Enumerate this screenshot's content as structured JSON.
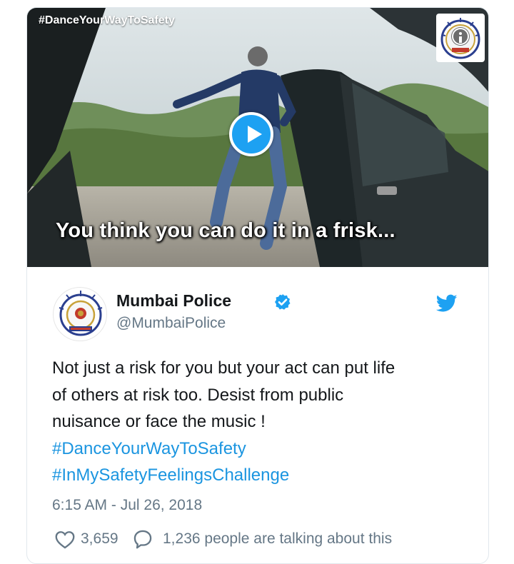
{
  "media": {
    "hashtag_overlay": "#DanceYourWayToSafety",
    "subtitle": "You think you can do it in a frisk...",
    "play_icon": "play-icon",
    "info_icon": "info-icon"
  },
  "tweet": {
    "display_name": "Mumbai Police",
    "handle": "@MumbaiPolice",
    "verified_icon": "verified-badge-icon",
    "brand_icon": "twitter-bird-icon",
    "text_lines": [
      "Not just a risk for you but your act can put life",
      "of others at risk too. Desist from public",
      "nuisance or face the music !"
    ],
    "hashtags": [
      "#DanceYourWayToSafety",
      "#InMySafetyFeelingsChallenge"
    ],
    "timestamp": "6:15 AM - Jul 26, 2018",
    "like_count": "3,659",
    "talking_text": "1,236 people are talking about this"
  },
  "colors": {
    "accent": "#1da1f2",
    "hashtag": "#1b95e0",
    "secondary_text": "#657786",
    "primary_text": "#14171a"
  }
}
